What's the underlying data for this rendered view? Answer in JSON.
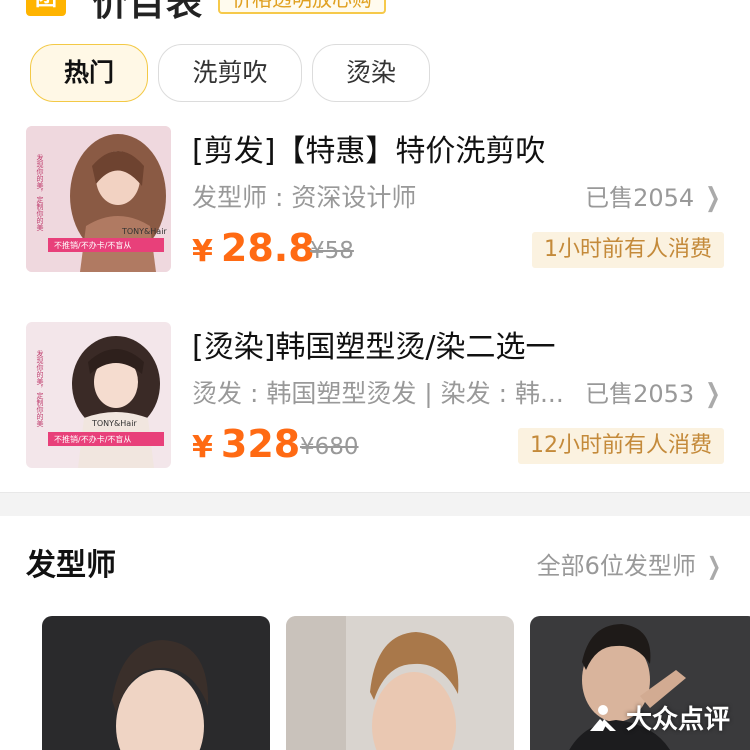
{
  "header": {
    "badge": "团",
    "title": "价目表",
    "slogan": "价格透明放心购"
  },
  "tabs": [
    {
      "label": "热门",
      "active": true
    },
    {
      "label": "洗剪吹",
      "active": false
    },
    {
      "label": "烫染",
      "active": false
    }
  ],
  "products": [
    {
      "title": "[剪发]【特惠】特价洗剪吹",
      "subtitle": "发型师 : 资深设计师",
      "sold": "已售2054",
      "currency": "¥",
      "price": "28.8",
      "original_price": "¥58",
      "tag": "1小时前有人消费",
      "thumb": {
        "brand": "TONY&Hair",
        "slogan": "不推销/不办卡/不盲从",
        "side_text": "发现你的美，定制你的美"
      }
    },
    {
      "title": "[烫染]韩国塑型烫/染二选一",
      "subtitle": "烫发 : 韩国塑型烫发 | 染发 : 韩...",
      "sold": "已售2053",
      "currency": "¥",
      "price": "328",
      "original_price": "¥680",
      "tag": "12小时前有人消费",
      "thumb": {
        "brand": "TONY&Hair",
        "slogan": "不推销/不办卡/不盲从",
        "side_text": "发现你的美，定制你的美"
      }
    }
  ],
  "stylists": {
    "heading": "发型师",
    "all_link": "全部6位发型师"
  },
  "watermark": "大众点评",
  "colors": {
    "accent_orange": "#ff6a13",
    "tab_active_bg": "#fff8e6",
    "tab_active_border": "#f3c946",
    "tag_bg": "#fbf2e0",
    "tag_text": "#c48a3a",
    "thumb_pink": "#e8407a"
  }
}
